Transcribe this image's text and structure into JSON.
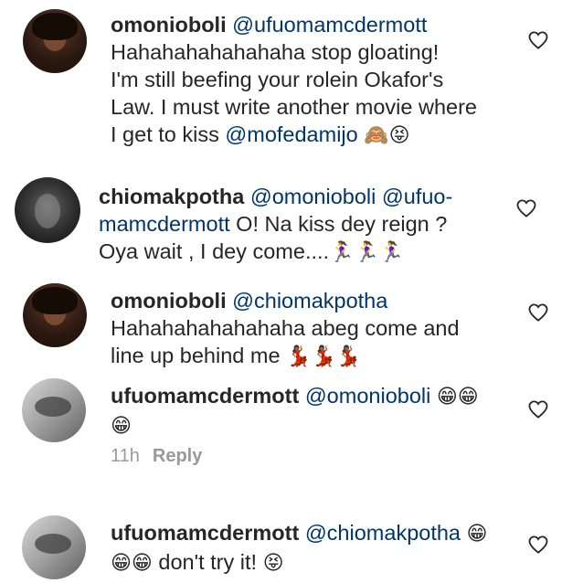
{
  "comments": [
    {
      "username": "omonioboli",
      "mention": "@ufuomamcdermott",
      "lines": [
        "Hahahahahahahaha stop gloating!",
        "I'm still beefing your rolein Okafor's",
        "Law. I must write another movie where",
        "I get to kiss "
      ],
      "mention2": "@mofedamijo",
      "emoji": "🙈😝"
    },
    {
      "username": "chiomakpotha",
      "mention": "@omonioboli @ufuo-",
      "mention_cont": "mamcdermott",
      "line2_rest": " O! Na kiss dey reign ?",
      "line3": "Oya wait , I dey come....",
      "emoji": "🏃‍♀️🏃‍♀️🏃‍♀️"
    },
    {
      "username": "omonioboli",
      "mention": "@chiomakpotha",
      "line2": "Hahahahahahahaha abeg come and",
      "line3": "line up behind me ",
      "emoji": "💃🏾💃🏾💃🏾"
    },
    {
      "username": "ufuomamcdermott",
      "mention": "@omonioboli",
      "emoji1": "😁😁",
      "emoji2": "😁",
      "time": "11h",
      "reply": "Reply"
    },
    {
      "username": "ufuomamcdermott",
      "mention": "@chiomakpotha",
      "emoji1": "😁",
      "emoji2": "😁😁",
      "rest": " don't try it! ",
      "emoji3": "😝"
    }
  ],
  "icons": {
    "heart": "heart-outline-icon"
  },
  "colors": {
    "mention": "#003569",
    "text": "#262626",
    "meta": "#999999"
  }
}
